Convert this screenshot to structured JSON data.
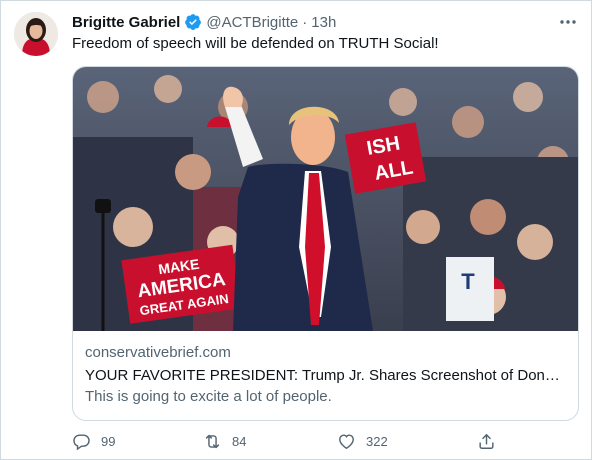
{
  "tweet": {
    "author_name": "Brigitte Gabriel",
    "handle": "@ACTBrigitte",
    "separator": "·",
    "time": "13h",
    "text": "Freedom of speech will be defended on TRUTH Social!"
  },
  "card": {
    "domain": "conservativebrief.com",
    "title": "YOUR FAVORITE PRESIDENT: Trump Jr. Shares Screenshot of Donald ...",
    "description": "This is going to excite a lot of people.",
    "image": {
      "sign_left_lines": [
        "MAKE",
        "AMERICA",
        "GREAT AGAIN"
      ],
      "sign_right_lines": [
        "ISH",
        "ALL"
      ],
      "sign_small": "T"
    }
  },
  "actions": {
    "replies": "99",
    "retweets": "84",
    "likes": "322"
  },
  "colors": {
    "text_primary": "#0f1419",
    "text_secondary": "#536471",
    "verified_blue": "#1d9bf0",
    "border": "#cfd9de"
  }
}
